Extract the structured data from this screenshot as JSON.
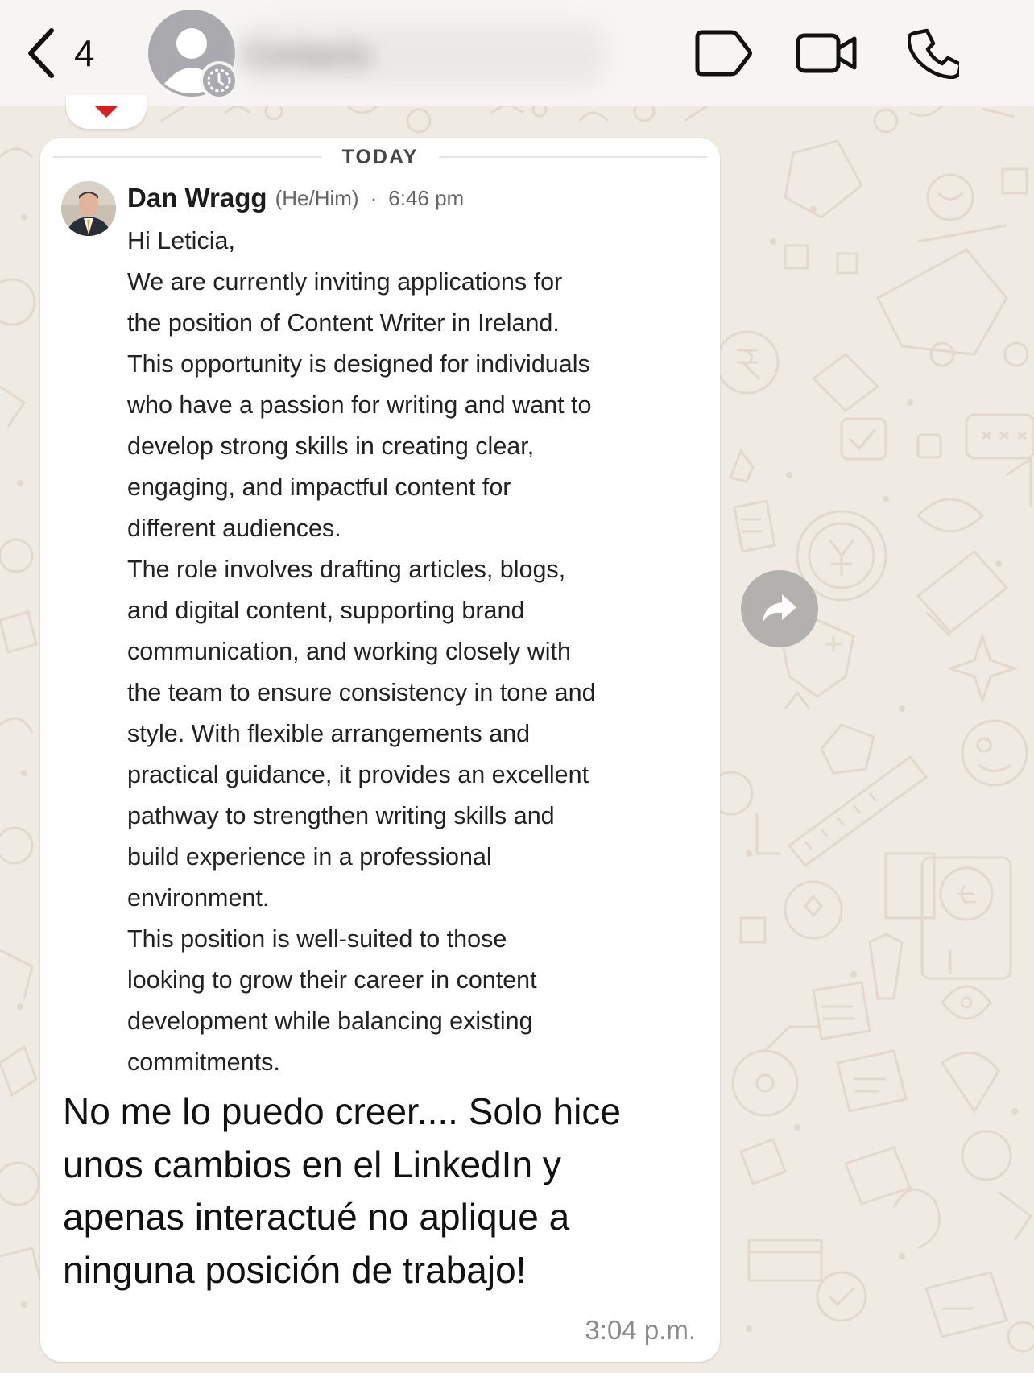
{
  "header": {
    "back_count": "4",
    "contact_name": "Contacto",
    "icons": [
      "chevron-left-icon",
      "label-tag-icon",
      "video-camera-icon",
      "phone-icon"
    ]
  },
  "quote": {
    "date_separator": "TODAY",
    "sender_name": "Dan Wragg",
    "sender_pronouns": "(He/Him)",
    "separator_dot": "·",
    "time": "6:46 pm",
    "lines": [
      "Hi Leticia,",
      "We are currently inviting applications for",
      "the position of Content Writer in Ireland.",
      "This opportunity is designed for individuals",
      "who have a passion for writing and want to",
      "develop strong skills in creating clear,",
      "engaging, and impactful content for",
      "different audiences.",
      "The role involves drafting articles, blogs,",
      "and digital content, supporting brand",
      "communication, and working closely with",
      "the team to ensure consistency in tone and",
      "style. With flexible arrangements and",
      "practical guidance, it provides an excellent",
      "pathway to strengthen writing skills and",
      "build experience in a professional",
      "environment.",
      "This position is well-suited to those",
      "looking to grow their career in content",
      "development while balancing existing",
      "commitments."
    ]
  },
  "message": {
    "lines": [
      "No me lo puedo creer.... Solo hice",
      "unos cambios en el LinkedIn y",
      "apenas interactué no aplique a",
      "ninguna posición de trabajo!"
    ],
    "time": "3:04 p.m."
  },
  "colors": {
    "header_bg": "#f6f5f3",
    "wallpaper_bg": "#efeae2",
    "bubble_bg": "#ffffff",
    "forward_button": "#b3b1ae",
    "reaction_heart": "#d92020"
  }
}
